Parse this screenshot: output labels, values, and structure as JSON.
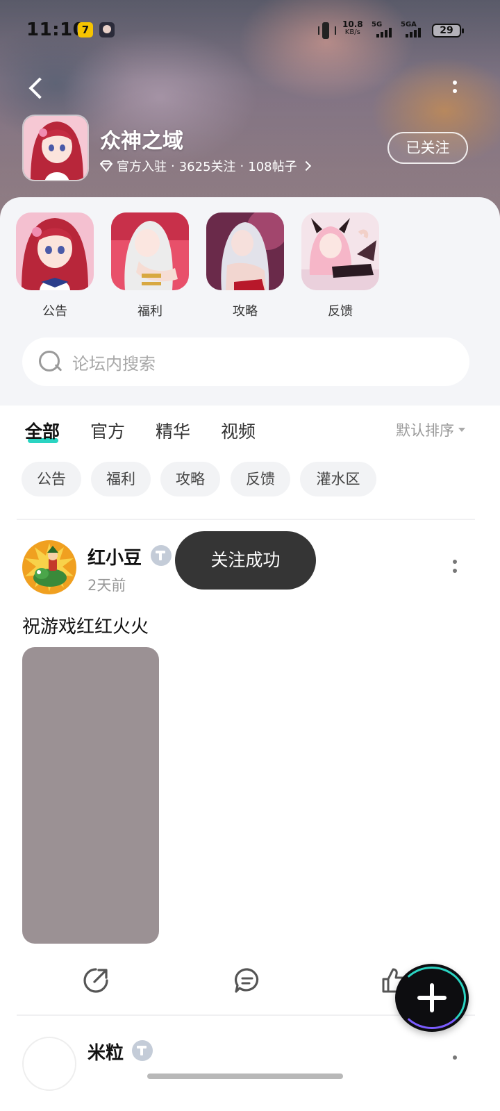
{
  "status_bar": {
    "time": "11:10",
    "app_icon_text": "7",
    "speed_value": "10.8",
    "speed_unit": "KB/s",
    "network_1": "5G",
    "network_2": "5GA",
    "battery": "29"
  },
  "forum": {
    "title": "众神之域",
    "meta_official": "官方入驻",
    "meta_followers": "3625关注",
    "meta_posts": "108帖子",
    "separator": "·",
    "follow_button": "已关注"
  },
  "sections": [
    {
      "label": "公告",
      "icon": "announcement-thumb"
    },
    {
      "label": "福利",
      "icon": "welfare-thumb"
    },
    {
      "label": "攻略",
      "icon": "guide-thumb"
    },
    {
      "label": "反馈",
      "icon": "feedback-thumb"
    }
  ],
  "search": {
    "placeholder": "论坛内搜索"
  },
  "tabs": [
    {
      "label": "全部",
      "active": true
    },
    {
      "label": "官方",
      "active": false
    },
    {
      "label": "精华",
      "active": false
    },
    {
      "label": "视频",
      "active": false
    }
  ],
  "sort": {
    "label": "默认排序"
  },
  "chips": [
    "公告",
    "福利",
    "攻略",
    "反馈",
    "灌水区"
  ],
  "post": {
    "username": "红小豆",
    "time": "2天前",
    "text": "祝游戏红红火火"
  },
  "toast": "关注成功",
  "post2": {
    "username": "米粒"
  },
  "colors": {
    "accent": "#2ad4c2",
    "toast_bg": "#353535",
    "image_placeholder": "#9b9194"
  }
}
